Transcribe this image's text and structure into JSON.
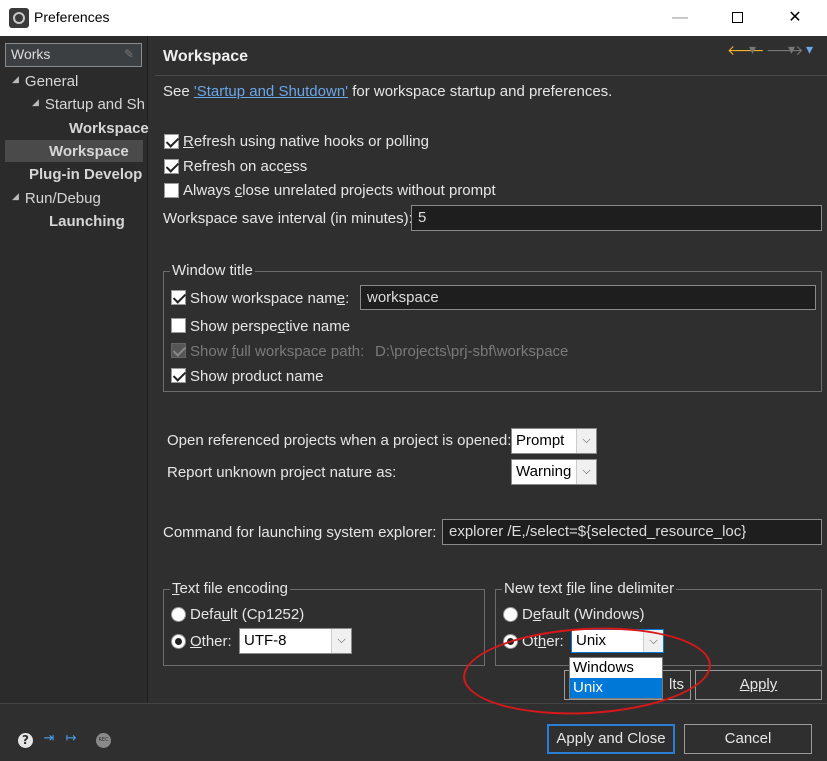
{
  "window": {
    "title": "Preferences",
    "minimize": "—",
    "close": "✕"
  },
  "sidebar": {
    "filter_value": "Works",
    "items": [
      {
        "label": "General",
        "twisty": "◢"
      },
      {
        "label": "Startup and Sh",
        "twisty": "◢"
      },
      {
        "label": "Workspace"
      },
      {
        "label": "Workspace"
      },
      {
        "label": "Plug-in Develop"
      },
      {
        "label": "Run/Debug",
        "twisty": "◢"
      },
      {
        "label": "Launching"
      }
    ]
  },
  "page": {
    "title": "Workspace",
    "intro_prefix": "See ",
    "intro_link": "'Startup and Shutdown'",
    "intro_suffix": " for workspace startup and preferences.",
    "refresh_native": {
      "u": "R",
      "rest": "efresh using native hooks or polling"
    },
    "refresh_access": {
      "pre": "Refresh on acc",
      "u": "e",
      "post": "ss"
    },
    "always_close": {
      "pre": "Always ",
      "u": "c",
      "post": "lose unrelated projects without prompt"
    },
    "save_interval_label": "Workspace save interval (in minutes):",
    "save_interval_value": "5",
    "window_title_group": "Window title",
    "show_ws_name": {
      "pre": "Show workspace nam",
      "u": "e",
      "post": ":"
    },
    "ws_name_value": "workspace",
    "show_perspective": {
      "pre": "Show perspe",
      "u": "c",
      "post": "tive name"
    },
    "show_full_path": {
      "pre": "Show ",
      "u": "f",
      "post": "ull workspace path:"
    },
    "full_path_value": "D:\\projects\\prj-sbf\\workspace",
    "show_product": "Show product name",
    "open_ref_label": "Open referenced projects when a project is opened:",
    "open_ref_value": "Prompt",
    "report_label": "Report unknown project nature as:",
    "report_value": "Warning",
    "cmd_label": "Command for launching system explorer:",
    "cmd_value": "explorer /E,/select=${selected_resource_loc}",
    "encoding_group": {
      "u": "T",
      "rest": "ext file encoding"
    },
    "enc_default": {
      "pre": "Defa",
      "u": "u",
      "post": "lt (Cp1252)"
    },
    "enc_other": {
      "u": "O",
      "rest": "ther:"
    },
    "enc_value": "UTF-8",
    "delim_group": {
      "pre": "New text ",
      "u": "f",
      "post": "ile line delimiter"
    },
    "delim_default": {
      "pre": "D",
      "u": "e",
      "post": "fault (Windows)"
    },
    "delim_other": {
      "pre": "Ot",
      "u": "h",
      "post": "er:"
    },
    "delim_value": "Unix",
    "delim_options": [
      "Windows",
      "Unix"
    ],
    "restore_defaults_visible": "lts",
    "apply": "Apply"
  },
  "footer": {
    "apply_close": "Apply and Close",
    "cancel": "Cancel"
  },
  "colors": {
    "accent": "#0078d7",
    "link": "#6aa6e8",
    "annotation": "#d81818"
  }
}
